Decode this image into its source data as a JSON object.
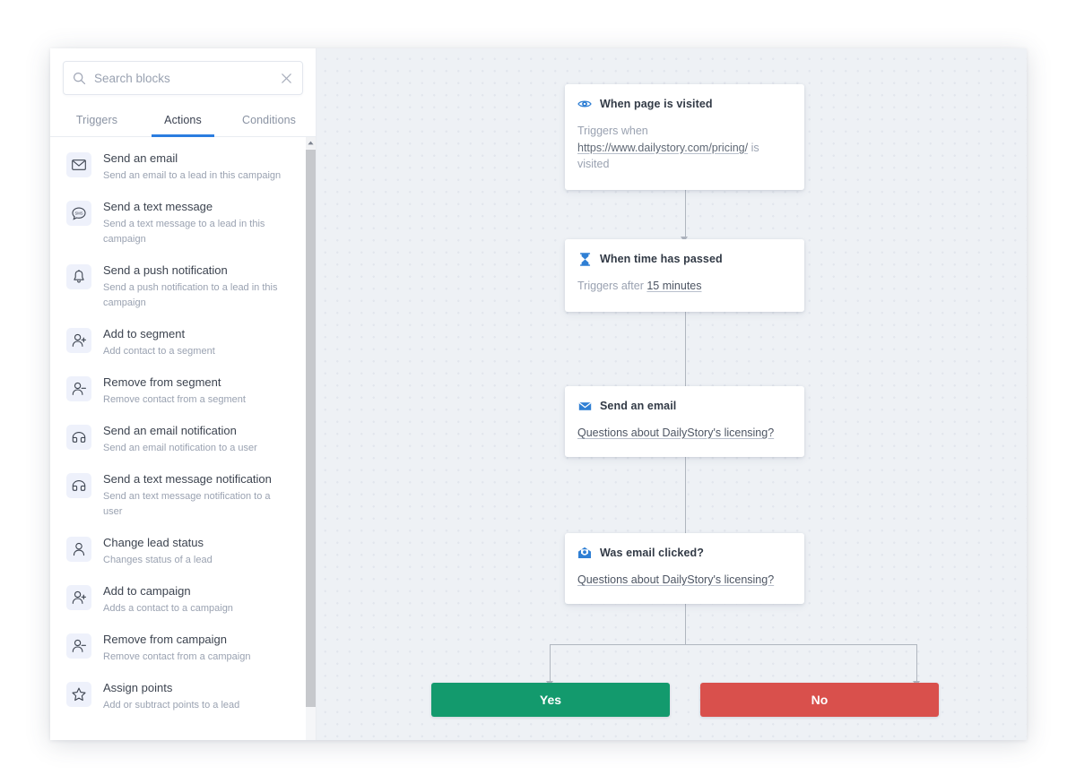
{
  "sidebar": {
    "search": {
      "placeholder": "Search blocks",
      "value": "",
      "search_icon": "search-icon",
      "clear_icon": "close-icon"
    },
    "tabs": [
      {
        "label": "Triggers",
        "active": false
      },
      {
        "label": "Actions",
        "active": true
      },
      {
        "label": "Conditions",
        "active": false
      }
    ],
    "accent_color": "#2b7de0",
    "blocks": [
      {
        "title": "Send an email",
        "desc": "Send an email to a lead in this campaign",
        "icon": "envelope-icon"
      },
      {
        "title": "Send a text message",
        "desc": "Send a text message to a lead in this campaign",
        "icon": "chat-bubble-icon"
      },
      {
        "title": "Send a push notification",
        "desc": "Send a push notification to a lead in this campaign",
        "icon": "bell-icon"
      },
      {
        "title": "Add to segment",
        "desc": "Add contact to a segment",
        "icon": "user-plus-icon"
      },
      {
        "title": "Remove from segment",
        "desc": "Remove contact from a segment",
        "icon": "user-minus-icon"
      },
      {
        "title": "Send an email notification",
        "desc": "Send an email notification to a user",
        "icon": "notification-icon"
      },
      {
        "title": "Send a text message notification",
        "desc": "Send an text message notification to a user",
        "icon": "notification-icon"
      },
      {
        "title": "Change lead status",
        "desc": "Changes status of a lead",
        "icon": "user-icon"
      },
      {
        "title": "Add to campaign",
        "desc": "Adds a contact to a campaign",
        "icon": "user-plus-icon"
      },
      {
        "title": "Remove from campaign",
        "desc": "Remove contact from a campaign",
        "icon": "user-minus-icon"
      },
      {
        "title": "Assign points",
        "desc": "Add or subtract points to a lead",
        "icon": "star-icon"
      }
    ]
  },
  "canvas": {
    "nodes": [
      {
        "id": "page-visited",
        "title": "When page is visited",
        "icon": "eye-icon",
        "body_prefix": "Triggers when ",
        "body_link": "https://www.dailystory.com/pricing/",
        "body_suffix": " is visited"
      },
      {
        "id": "time-passed",
        "title": "When time has passed",
        "icon": "hourglass-icon",
        "body_prefix": "Triggers after ",
        "body_link": "15 minutes",
        "body_suffix": ""
      },
      {
        "id": "send-email",
        "title": "Send an email",
        "icon": "envelope-icon",
        "body_prefix": "",
        "body_link": "Questions about DailyStory's licensing?",
        "body_suffix": ""
      },
      {
        "id": "email-clicked",
        "title": "Was email clicked?",
        "icon": "email-open-icon",
        "body_prefix": "",
        "body_link": "Questions about DailyStory's licensing?",
        "body_suffix": ""
      }
    ],
    "branches": [
      {
        "label": "Yes",
        "color": "#139a6d"
      },
      {
        "label": "No",
        "color": "#d9504c"
      }
    ]
  }
}
